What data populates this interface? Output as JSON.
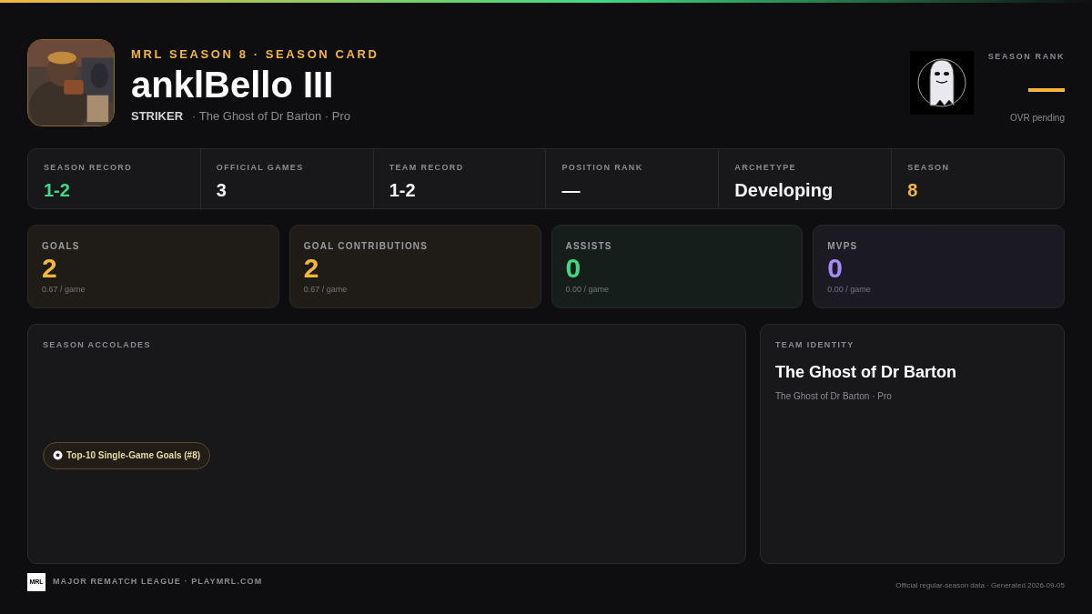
{
  "header": {
    "eyebrow": "MRL SEASON 8 · SEASON CARD",
    "player_name": "anklBello III",
    "position": "STRIKER",
    "team_line": "· The Ghost of Dr Barton · Pro"
  },
  "season_rank": {
    "label": "SEASON RANK",
    "value": "—",
    "note": "OVR pending"
  },
  "summary": [
    {
      "label": "SEASON RECORD",
      "value": "1-2",
      "color": "#3ddc84"
    },
    {
      "label": "OFFICIAL GAMES",
      "value": "3",
      "color": "#f4f4f5"
    },
    {
      "label": "TEAM RECORD",
      "value": "1-2",
      "color": "#f4f4f5"
    },
    {
      "label": "POSITION RANK",
      "value": "—",
      "color": "#f4f4f5"
    },
    {
      "label": "ARCHETYPE",
      "value": "Developing",
      "color": "#f4f4f5"
    },
    {
      "label": "SEASON",
      "value": "8",
      "color": "#f5b73b"
    }
  ],
  "stats": [
    {
      "label": "GOALS",
      "value": "2",
      "per_game": "0.67 / game",
      "color": "#f5b73b"
    },
    {
      "label": "GOAL CONTRIBUTIONS",
      "value": "2",
      "per_game": "0.67 / game",
      "color": "#f5b73b"
    },
    {
      "label": "ASSISTS",
      "value": "0",
      "per_game": "0.00 / game",
      "color": "#3ddc84"
    },
    {
      "label": "MVPS",
      "value": "0",
      "per_game": "0.00 / game",
      "color": "#a78bfa"
    }
  ],
  "accolades": {
    "title": "SEASON ACCOLADES",
    "items": [
      {
        "text": "Top-10 Single-Game Goals (#8)"
      }
    ]
  },
  "team_identity": {
    "title": "TEAM IDENTITY",
    "name": "The Ghost of Dr Barton",
    "sub": "The Ghost of Dr Barton · Pro"
  },
  "footer": {
    "logo_text": "MRL",
    "left": "MAJOR REMATCH LEAGUE · PLAYMRL.COM",
    "right": "Official regular-season data · Generated 2026-09-05"
  }
}
